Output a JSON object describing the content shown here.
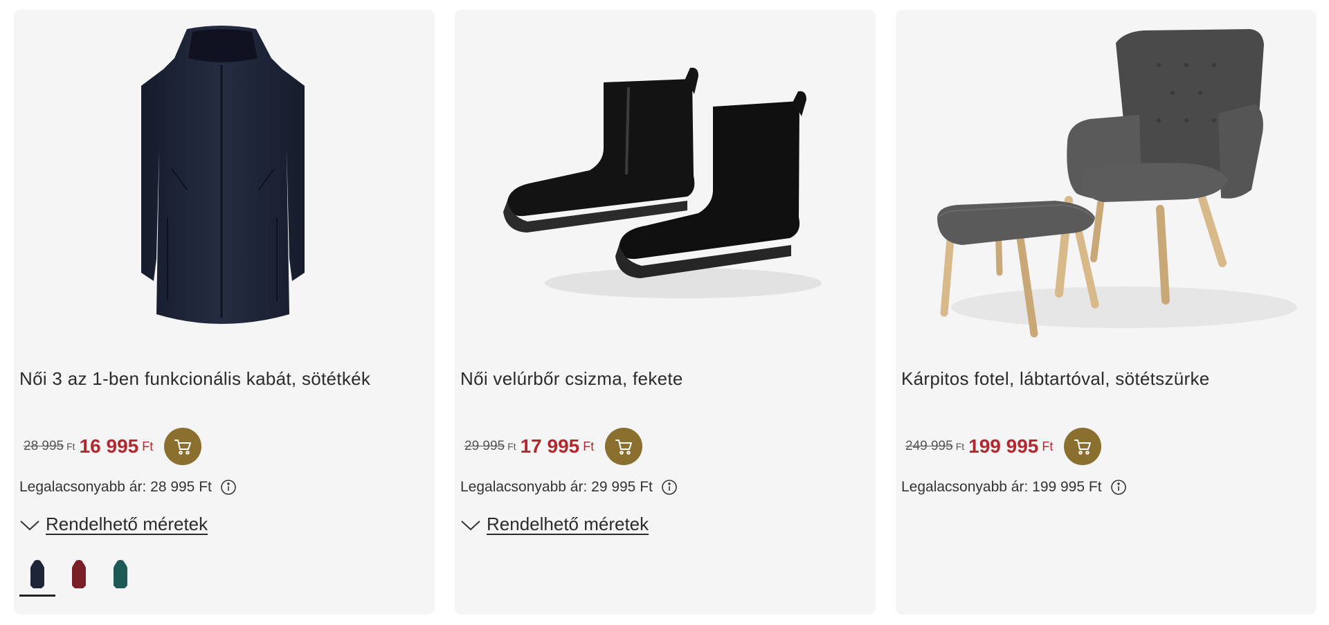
{
  "products": [
    {
      "title": "Női 3 az 1-ben funkcionális kabát, sötétkék",
      "old_price": "28 995",
      "old_currency": "Ft",
      "new_price": "16 995",
      "new_currency": "Ft",
      "lowest_price": "Legalacsonyabb ár: 28 995 Ft",
      "sizes_label": "Rendelhető méretek",
      "image": "navy-coat",
      "swatch_colors": [
        "#1f2538",
        "#7a1e28",
        "#1d5a57"
      ]
    },
    {
      "title": "Női velúrbőr csizma, fekete",
      "old_price": "29 995",
      "old_currency": "Ft",
      "new_price": "17 995",
      "new_currency": "Ft",
      "lowest_price": "Legalacsonyabb ár: 29 995 Ft",
      "sizes_label": "Rendelhető méretek",
      "image": "black-suede-boots"
    },
    {
      "title": "Kárpitos fotel, lábtartóval, sötétszürke",
      "old_price": "249 995",
      "old_currency": "Ft",
      "new_price": "199 995",
      "new_currency": "Ft",
      "lowest_price": "Legalacsonyabb ár: 199 995 Ft",
      "image": "grey-armchair-with-footstool"
    }
  ],
  "colors": {
    "card_bg": "#f5f5f5",
    "sale_price": "#b2282e",
    "cart_button": "#8a6f2e"
  },
  "icons": [
    "cart-icon",
    "info-icon",
    "chevron-down-icon"
  ]
}
